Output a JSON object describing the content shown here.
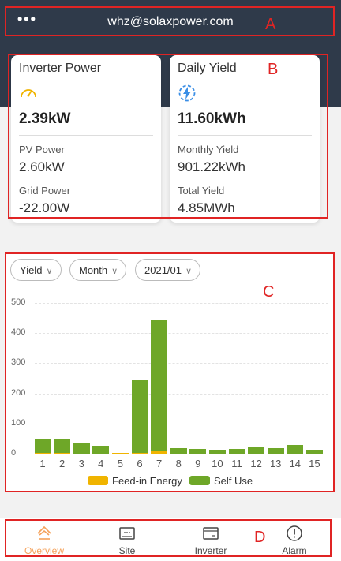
{
  "header": {
    "menu_glyph": "•••",
    "email": "whz@solaxpower.com"
  },
  "annotations": {
    "a": "A",
    "b": "B",
    "c": "C",
    "d": "D"
  },
  "inverter_card": {
    "title": "Inverter Power",
    "icon": "gauge-icon",
    "value": "2.39kW",
    "pv_label": "PV Power",
    "pv_value": "2.60kW",
    "grid_label": "Grid Power",
    "grid_value": "-22.00W"
  },
  "yield_card": {
    "title": "Daily Yield",
    "icon": "lightning-bolt-icon",
    "value": "11.60kWh",
    "monthly_label": "Monthly Yield",
    "monthly_value": "901.22kWh",
    "total_label": "Total Yield",
    "total_value": "4.85MWh"
  },
  "filters": {
    "type": "Yield",
    "period": "Month",
    "date": "2021/01"
  },
  "chart_data": {
    "type": "bar",
    "categories": [
      "1",
      "2",
      "3",
      "4",
      "5",
      "6",
      "7",
      "8",
      "9",
      "10",
      "11",
      "12",
      "13",
      "14",
      "15"
    ],
    "ylim": [
      0,
      500
    ],
    "yticks": [
      "0",
      "100",
      "200",
      "300",
      "400",
      "500"
    ],
    "series": [
      {
        "name": "Feed-in Energy",
        "color": "#f0b400",
        "values": [
          2,
          2,
          1,
          1,
          2,
          2,
          8,
          1,
          1,
          1,
          1,
          1,
          1,
          1,
          1
        ]
      },
      {
        "name": "Self Use",
        "color": "#6ea728",
        "values": [
          46,
          44,
          33,
          25,
          1,
          245,
          437,
          17,
          14,
          13,
          15,
          20,
          17,
          27,
          13
        ]
      }
    ],
    "legend_position": "bottom"
  },
  "nav": {
    "items": [
      {
        "label": "Overview",
        "icon": "home-icon"
      },
      {
        "label": "Site",
        "icon": "site-icon"
      },
      {
        "label": "Inverter",
        "icon": "inverter-icon"
      },
      {
        "label": "Alarm",
        "icon": "alert-icon"
      }
    ],
    "active_color": "#f5a15a"
  }
}
